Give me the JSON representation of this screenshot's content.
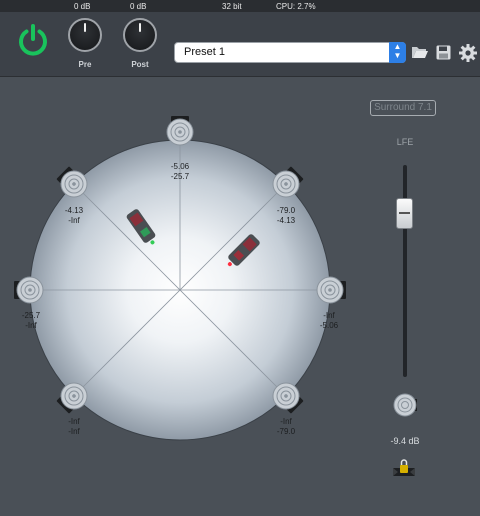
{
  "header": {
    "pre_gain": "0 dB",
    "post_gain": "0 dB",
    "bit_depth": "32 bit",
    "cpu": "CPU: 2.7%"
  },
  "toolbar": {
    "power_icon": "power-icon",
    "pre_label": "Pre",
    "post_label": "Post",
    "preset": {
      "selected": "Preset 1"
    },
    "icons": [
      "folder-open-icon",
      "save-icon",
      "gear-icon"
    ],
    "accent_color": "#19c35c",
    "select_color": "#2d7fe6"
  },
  "panner": {
    "speakers": [
      {
        "name": "speaker-top",
        "v1": "-5.06",
        "v2": "-25.7"
      },
      {
        "name": "speaker-upper-left",
        "v1": "-4.13",
        "v2": "-Inf"
      },
      {
        "name": "speaker-upper-right",
        "v1": "-79.0",
        "v2": "-4.13"
      },
      {
        "name": "speaker-left",
        "v1": "-25.7",
        "v2": "-Inf"
      },
      {
        "name": "speaker-right",
        "v1": "-Inf",
        "v2": "-5.06"
      },
      {
        "name": "speaker-lower-left",
        "v1": "-Inf",
        "v2": "-Inf"
      },
      {
        "name": "speaker-lower-right",
        "v1": "-Inf",
        "v2": "-79.0"
      }
    ],
    "sources": [
      {
        "name": "source-left",
        "indicator_color": "#33cc55"
      },
      {
        "name": "source-right",
        "indicator_color": "#ff3040"
      }
    ]
  },
  "right_panel": {
    "surround_label": "Surround 7.1",
    "lfe_label": "LFE",
    "lfe_level": "-9.4 dB",
    "lfe_speaker_icon": "speaker-icon",
    "link_icon": "lock-icon"
  }
}
